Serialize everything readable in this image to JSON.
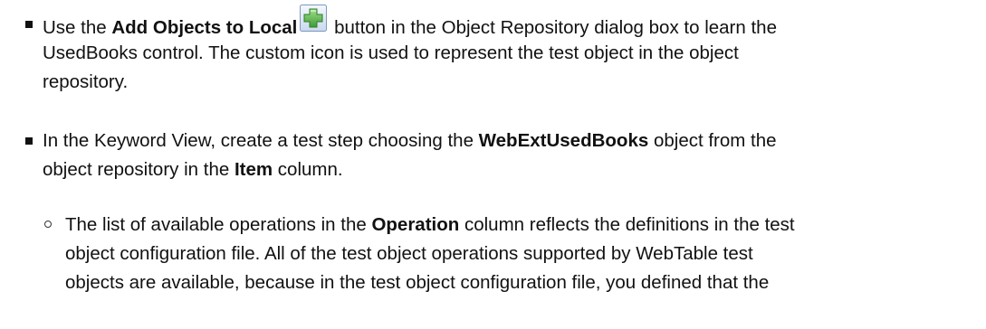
{
  "bullets": [
    {
      "lines": [
        [
          "Use the ",
          {
            "b": "Add Objects to Local"
          },
          {
            "icon": "add-objects-icon"
          },
          " button in the Object Repository dialog box to learn the"
        ],
        [
          "UsedBooks control. The custom icon is used to represent the test object in the object"
        ],
        [
          "repository."
        ]
      ]
    },
    {
      "lines": [
        [
          "In the Keyword View, create a test step choosing the ",
          {
            "b": "WebExtUsedBooks"
          },
          " object from the"
        ],
        [
          "object repository in the ",
          {
            "b": "Item"
          },
          " column."
        ]
      ]
    }
  ],
  "sub_bullets": [
    {
      "lines": [
        [
          "The list of available operations in the ",
          {
            "b": "Operation"
          },
          " column reflects the definitions in the test"
        ],
        [
          "object configuration file. All of the test object operations supported by WebTable test"
        ],
        [
          "objects are available, because in the test object configuration file, you defined that the"
        ]
      ]
    }
  ],
  "colors": {
    "text": "#111111",
    "icon_frame": "#8aa4c4",
    "icon_fill": "#dfe9f5",
    "icon_plus": "#5bb14a"
  }
}
